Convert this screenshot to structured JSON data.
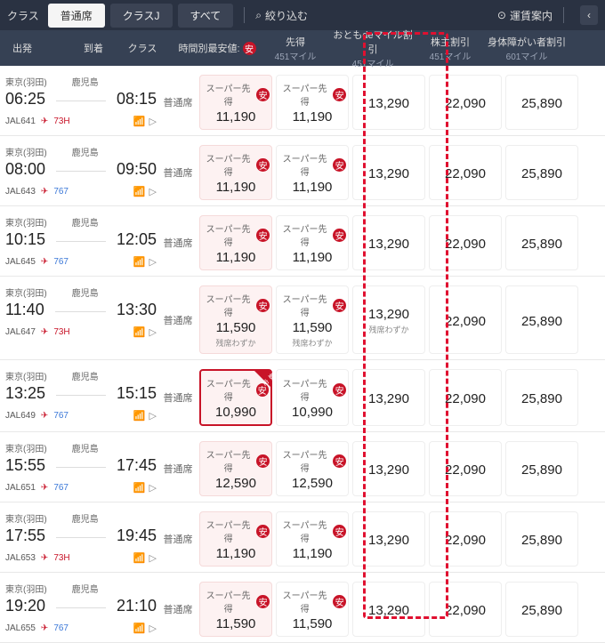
{
  "topbar": {
    "class_label": "クラス",
    "tabs": [
      "普通席",
      "クラスJ",
      "すべて"
    ],
    "filter": "絞り込む",
    "fareguide": "運賃案内"
  },
  "header": {
    "dep": "出発",
    "arr": "到着",
    "cls": "クラス",
    "lowfare": "時間別最安値:",
    "sakitoku": "先得",
    "sakitoku_sub": "451マイル",
    "otomo": "おともdeマイル割引",
    "otomo_sub": "451マイル",
    "kabu": "株主割引",
    "kabu_sub": "451マイル",
    "shintai": "身体障がい者割引",
    "shintai_sub": "601マイル",
    "an": "安"
  },
  "badge_super": "スーパー先得",
  "note_few": "残席わずか",
  "dep_airport": "東京(羽田)",
  "arr_airport": "鹿児島",
  "cls_val": "普通席",
  "flights": [
    {
      "dep": "06:25",
      "arr": "08:15",
      "no": "JAL641",
      "ac": "73H",
      "acred": true,
      "p1": "11,190",
      "p2": "11,190",
      "p3": "13,290",
      "p4": "22,090",
      "p5": "25,890",
      "note": ""
    },
    {
      "dep": "08:00",
      "arr": "09:50",
      "no": "JAL643",
      "ac": "767",
      "acred": false,
      "p1": "11,190",
      "p2": "11,190",
      "p3": "13,290",
      "p4": "22,090",
      "p5": "25,890",
      "note": ""
    },
    {
      "dep": "10:15",
      "arr": "12:05",
      "no": "JAL645",
      "ac": "767",
      "acred": false,
      "p1": "11,190",
      "p2": "11,190",
      "p3": "13,290",
      "p4": "22,090",
      "p5": "25,890",
      "note": ""
    },
    {
      "dep": "11:40",
      "arr": "13:30",
      "no": "JAL647",
      "ac": "73H",
      "acred": true,
      "p1": "11,590",
      "p2": "11,590",
      "p3": "13,290",
      "p4": "22,090",
      "p5": "25,890",
      "note": "few"
    },
    {
      "dep": "13:25",
      "arr": "15:15",
      "no": "JAL649",
      "ac": "767",
      "acred": false,
      "p1": "10,990",
      "p2": "10,990",
      "p3": "13,290",
      "p4": "22,090",
      "p5": "25,890",
      "note": "",
      "cheapest": true
    },
    {
      "dep": "15:55",
      "arr": "17:45",
      "no": "JAL651",
      "ac": "767",
      "acred": false,
      "p1": "12,590",
      "p2": "12,590",
      "p3": "13,290",
      "p4": "22,090",
      "p5": "25,890",
      "note": ""
    },
    {
      "dep": "17:55",
      "arr": "19:45",
      "no": "JAL653",
      "ac": "73H",
      "acred": true,
      "p1": "11,190",
      "p2": "11,190",
      "p3": "13,290",
      "p4": "22,090",
      "p5": "25,890",
      "note": ""
    },
    {
      "dep": "19:20",
      "arr": "21:10",
      "no": "JAL655",
      "ac": "767",
      "acred": false,
      "p1": "11,590",
      "p2": "11,590",
      "p3": "13,290",
      "p4": "22,090",
      "p5": "25,890",
      "note": ""
    }
  ]
}
